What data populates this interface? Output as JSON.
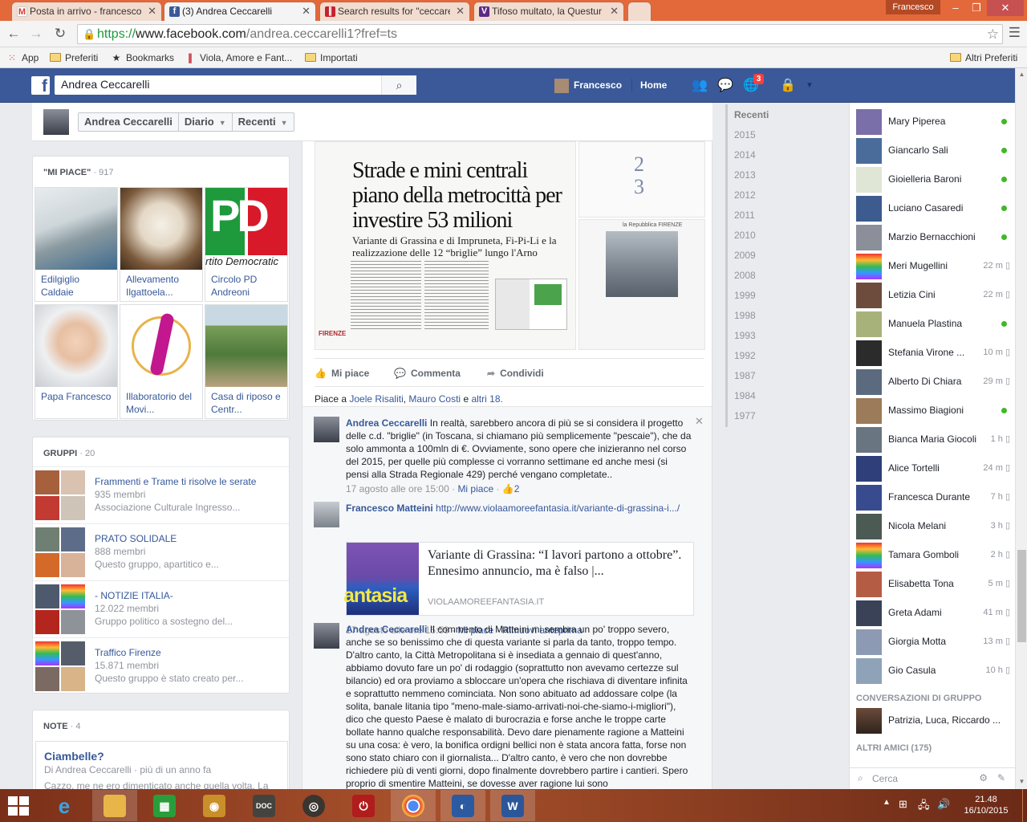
{
  "browser": {
    "tabs": [
      {
        "title": "Posta in arrivo - francesco",
        "icon": "gmail-icon",
        "active": false
      },
      {
        "title": "(3) Andrea Ceccarelli",
        "icon": "facebook-icon",
        "active": true
      },
      {
        "title": "Search results for \"ceccare",
        "icon": "viola-amore-icon",
        "active": false
      },
      {
        "title": "Tifoso multato, la Questur",
        "icon": "viola-news-icon",
        "active": false
      }
    ],
    "user": "Francesco",
    "url": {
      "scheme": "https://",
      "host": "www.facebook.com",
      "path": "/andrea.ceccarelli1?fref=ts"
    },
    "bookmarks": [
      "App",
      "Preferiti",
      "Bookmarks",
      "Viola, Amore e Fant...",
      "Importati"
    ],
    "other_bookmarks": "Altri Preferiti"
  },
  "fb": {
    "search_value": "Andrea Ceccarelli",
    "user_name": "Francesco",
    "home": "Home",
    "notifications": "3"
  },
  "profile": {
    "name": "Andrea Ceccarelli",
    "nav": [
      "Diario",
      "Recenti"
    ]
  },
  "likes": {
    "heading": "\"MI PIACE\"",
    "count": "917",
    "items": [
      {
        "label": "Edilgiglio Caldaie",
        "img": "office"
      },
      {
        "label": "Allevamento Ilgattoela...",
        "img": "dog"
      },
      {
        "label": "Circolo PD Andreoni",
        "img": "pd-logo"
      },
      {
        "label": "Papa Francesco",
        "img": "pope"
      },
      {
        "label": "Illaboratorio del Movi...",
        "img": "dancer"
      },
      {
        "label": "Casa di riposo e Centr...",
        "img": "villa"
      }
    ],
    "pd_text": "PD",
    "pd_caption": "rtito Democratic"
  },
  "groups": {
    "heading": "GRUPPI",
    "count": "20",
    "items": [
      {
        "name": "Frammenti e Trame ti risolve le serate",
        "members": "935 membri",
        "desc": "Associazione Culturale Ingresso..."
      },
      {
        "name": "PRATO SOLIDALE",
        "members": "888 membri",
        "desc": "Questo gruppo, apartitico e..."
      },
      {
        "name": "- NOTIZIE ITALIA-",
        "members": "12.022 membri",
        "desc": "Gruppo politico a sostegno del..."
      },
      {
        "name": "Traffico Firenze",
        "members": "15.871 membri",
        "desc": "Questo gruppo è stato creato per..."
      }
    ]
  },
  "notes": {
    "heading": "NOTE",
    "count": "4",
    "title": "Ciambelle?",
    "byline": "Di Andrea Ceccarelli · più di un anno fa",
    "snippet": "Cazzo, me ne ero dimenticato anche quella volta. La"
  },
  "post": {
    "newspaper_title": "Strade e mini centrali piano della metrocittà per investire 53 milioni",
    "newspaper_sub": "Variante di Grassina e di Impruneta, Fi-Pi-Li e la realizzazione delle 12 “briglie” lungo l'Arno",
    "newspaper_brand": "FIRENZE",
    "thumb_paper": "la Repubblica FIRENZE",
    "actions": [
      "Mi piace",
      "Commenta",
      "Condividi"
    ],
    "likes_prefix": "Piace a",
    "likers": [
      "Joele Risaliti",
      "Mauro Costi"
    ],
    "likes_and": "e",
    "likes_others": "altri 18."
  },
  "comments": [
    {
      "author": "Andrea Ceccarelli",
      "text": "In realtà, sarebbero ancora di più se si considera il progetto delle c.d. \"briglie\" (in Toscana, si chiamano più semplicemente \"pescaie\"), che da solo ammonta a 100mln di €. Ovviamente, sono opere che inizieranno nel corso del 2015, per quelle più complesse ci vorranno settimane ed anche mesi (si pensi alla Strada Regionale 429) perché vengano completate..",
      "time": "17 agosto alle ore 15:00",
      "like": "Mi piace",
      "likes": "2"
    },
    {
      "author": "Francesco Matteini",
      "link": "http://www.violaamoreefantasia.it/variante-di-grassina-i.../",
      "card_title": "Variante di Grassina: “I lavori partono a ottobre”. Ennesimo annuncio, ma è falso |...",
      "card_domain": "VIOLAAMOREEFANTASIA.IT",
      "card_img_text": "antasia",
      "time": "17 agosto alle ore 15:59",
      "like": "Mi piace",
      "remove": "Rimuovi anteprima"
    },
    {
      "author": "Andrea Ceccarelli",
      "text": "Il commento di Matteini mi sembra un po' troppo severo, anche se so benissimo che di questa variante si parla da tanto, troppo tempo. D'altro canto, la Città Metropolitana si è insediata a gennaio di quest'anno, abbiamo dovuto fare un po' di rodaggio (soprattutto non avevamo certezze sul bilancio) ed ora proviamo a sbloccare un'opera che rischiava di diventare infinita e soprattutto nemmeno cominciata. Non sono abituato ad addossare colpe (la solita, banale litania tipo \"meno-male-siamo-arrivati-noi-che-siamo-i-migliori\"), dico che questo Paese è malato di burocrazia e forse anche le troppe carte bollate hanno qualche responsabilità. Devo dare pienamente ragione a Matteini su una cosa: è vero, la bonifica ordigni bellici non è stata ancora fatta, forse non sono stato chiaro con il giornalista... D'altro canto, è vero che non dovrebbe richiedere più di venti giorni, dopo finalmente dovrebbero partire i cantieri. Spero proprio di smentire Matteini, se dovesse aver ragione lui sono"
    }
  ],
  "timeline_years": [
    "Recenti",
    "2015",
    "2014",
    "2013",
    "2012",
    "2011",
    "2010",
    "2009",
    "2008",
    "1999",
    "1998",
    "1993",
    "1992",
    "1987",
    "1984",
    "1977"
  ],
  "chat": {
    "friends": [
      {
        "name": "Mary Piperea",
        "online": true,
        "ago": ""
      },
      {
        "name": "Giancarlo Sali",
        "online": true,
        "ago": ""
      },
      {
        "name": "Gioielleria Baroni",
        "online": true,
        "ago": ""
      },
      {
        "name": "Luciano Casaredi",
        "online": true,
        "ago": ""
      },
      {
        "name": "Marzio Bernacchioni",
        "online": true,
        "ago": ""
      },
      {
        "name": "Meri Mugellini",
        "online": false,
        "ago": "22 m"
      },
      {
        "name": "Letizia Cini",
        "online": false,
        "ago": "22 m"
      },
      {
        "name": "Manuela Plastina",
        "online": true,
        "ago": ""
      },
      {
        "name": "Stefania Virone ...",
        "online": false,
        "ago": "10 m"
      },
      {
        "name": "Alberto Di Chiara",
        "online": false,
        "ago": "29 m"
      },
      {
        "name": "Massimo Biagioni",
        "online": true,
        "ago": ""
      },
      {
        "name": "Bianca Maria Giocoli",
        "online": false,
        "ago": "1 h"
      },
      {
        "name": "Alice Tortelli",
        "online": false,
        "ago": "24 m"
      },
      {
        "name": "Francesca Durante",
        "online": false,
        "ago": "7 h"
      },
      {
        "name": "Nicola Melani",
        "online": false,
        "ago": "3 h"
      },
      {
        "name": "Tamara Gomboli",
        "online": false,
        "ago": "2 h"
      },
      {
        "name": "Elisabetta Tona",
        "online": false,
        "ago": "5 m"
      },
      {
        "name": "Greta Adami",
        "online": false,
        "ago": "41 m"
      },
      {
        "name": "Giorgia Motta",
        "online": false,
        "ago": "13 m"
      },
      {
        "name": "Gio Casula",
        "online": false,
        "ago": "10 h"
      }
    ],
    "group_heading": "CONVERSAZIONI DI GRUPPO",
    "group_conv": "Patrizia, Luca, Riccardo ...",
    "others_heading": "ALTRI AMICI (175)",
    "search_placeholder": "Cerca"
  },
  "taskbar": {
    "apps": [
      "internet-explorer-icon",
      "file-explorer-icon",
      "store-icon",
      "app-icon",
      "doc-icon",
      "media-icon",
      "power-icon",
      "chrome-icon",
      "app2-icon",
      "word-icon"
    ],
    "time": "21.48",
    "date": "16/10/2015"
  },
  "colors": {
    "facebook_blue": "#3b5998",
    "link": "#365899",
    "online": "#42b72a",
    "chrome_frame": "#e3683a"
  }
}
